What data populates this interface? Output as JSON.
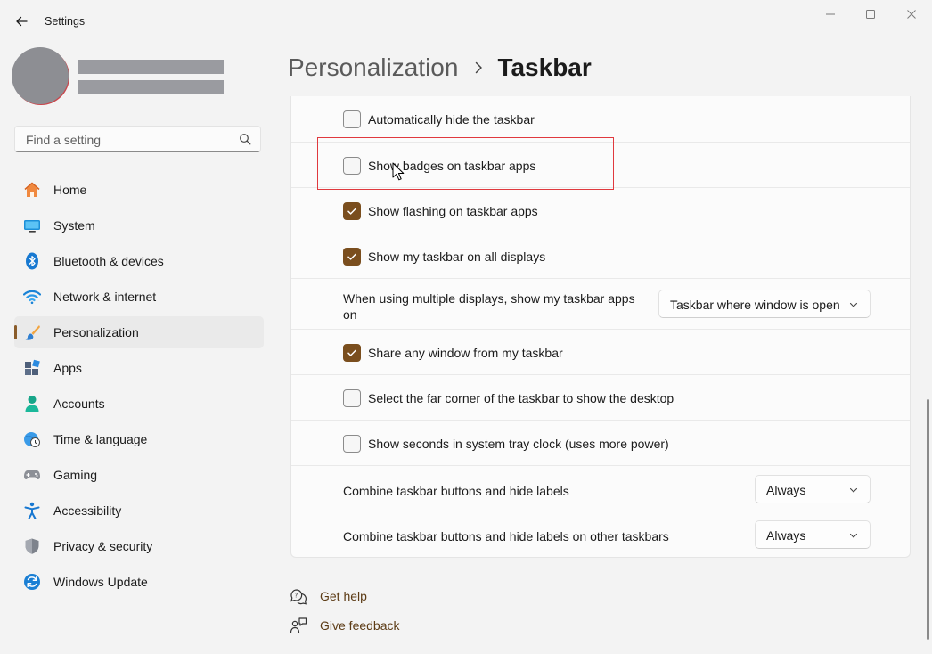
{
  "window": {
    "title": "Settings"
  },
  "search": {
    "placeholder": "Find a setting"
  },
  "nav": [
    {
      "label": "Home",
      "icon": "home-icon"
    },
    {
      "label": "System",
      "icon": "system-icon"
    },
    {
      "label": "Bluetooth & devices",
      "icon": "bluetooth-icon"
    },
    {
      "label": "Network & internet",
      "icon": "wifi-icon"
    },
    {
      "label": "Personalization",
      "icon": "paintbrush-icon",
      "selected": true
    },
    {
      "label": "Apps",
      "icon": "apps-icon"
    },
    {
      "label": "Accounts",
      "icon": "person-icon"
    },
    {
      "label": "Time & language",
      "icon": "clock-globe-icon"
    },
    {
      "label": "Gaming",
      "icon": "gamepad-icon"
    },
    {
      "label": "Accessibility",
      "icon": "accessibility-icon"
    },
    {
      "label": "Privacy & security",
      "icon": "shield-icon"
    },
    {
      "label": "Windows Update",
      "icon": "update-icon"
    }
  ],
  "header": {
    "parent": "Personalization",
    "current": "Taskbar"
  },
  "settings": [
    {
      "type": "checkbox",
      "label": "Automatically hide the taskbar",
      "checked": false
    },
    {
      "type": "checkbox",
      "label": "Show badges on taskbar apps",
      "checked": false
    },
    {
      "type": "checkbox",
      "label": "Show flashing on taskbar apps",
      "checked": true
    },
    {
      "type": "checkbox",
      "label": "Show my taskbar on all displays",
      "checked": true
    },
    {
      "type": "dropdown",
      "label_line1": "When using multiple displays, show my taskbar apps",
      "label_line2": "on",
      "value": "Taskbar where window is open"
    },
    {
      "type": "checkbox",
      "label": "Share any window from my taskbar",
      "checked": true
    },
    {
      "type": "checkbox",
      "label": "Select the far corner of the taskbar to show the desktop",
      "checked": false
    },
    {
      "type": "checkbox",
      "label": "Show seconds in system tray clock (uses more power)",
      "checked": false
    },
    {
      "type": "dropdown",
      "label": "Combine taskbar buttons and hide labels",
      "value": "Always"
    },
    {
      "type": "dropdown",
      "label": "Combine taskbar buttons and hide labels on other taskbars",
      "value": "Always"
    }
  ],
  "help": {
    "get_help": "Get help",
    "give_feedback": "Give feedback"
  },
  "colors": {
    "accent": "#7a4e1e",
    "link": "#5c3b15",
    "highlight_box": "#e0393e"
  }
}
